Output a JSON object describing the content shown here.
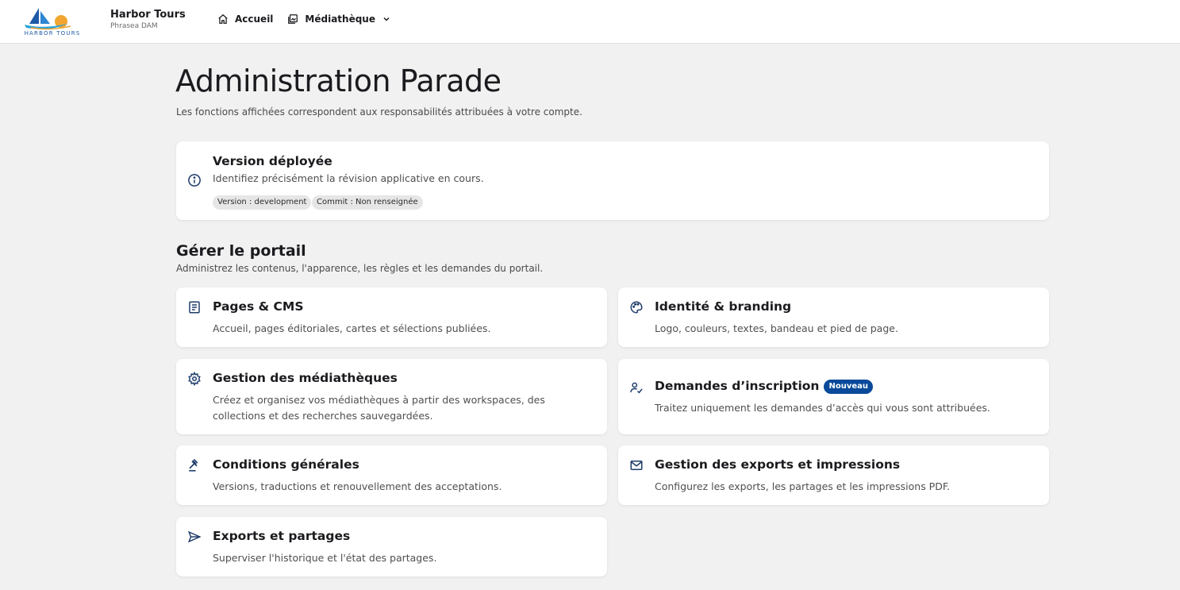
{
  "header": {
    "brand_name": "Harbor Tours",
    "brand_sub": "Phrasea DAM",
    "logo_text": "HARBOR TOURS",
    "nav": [
      {
        "label": "Accueil",
        "icon": "home-icon"
      },
      {
        "label": "Médiathèque",
        "icon": "library-icon"
      }
    ]
  },
  "page": {
    "title": "Administration Parade",
    "subtitle": "Les fonctions affichées correspondent aux responsabilités attribuées à votre compte."
  },
  "version_card": {
    "title": "Version déployée",
    "desc": "Identifiez précisément la révision applicative en cours.",
    "chips": [
      "Version : development",
      "Commit : Non renseignée"
    ],
    "icon": "info-icon"
  },
  "section": {
    "title": "Gérer le portail",
    "subtitle": "Administrez les contenus, l'apparence, les règles et les demandes du portail."
  },
  "cards": [
    {
      "title": "Pages & CMS",
      "desc": "Accueil, pages éditoriales, cartes et sélections publiées.",
      "icon": "document-icon"
    },
    {
      "title": "Identité & branding",
      "desc": "Logo, couleurs, textes, bandeau et pied de page.",
      "icon": "palette-icon"
    },
    {
      "title": "Gestion des médiathèques",
      "desc": "Créez et organisez vos médiathèques à partir des workspaces, des collections et des recherches sauvegardées.",
      "icon": "gear-icon"
    },
    {
      "title": "Demandes d’inscription",
      "badge": "Nouveau",
      "desc": "Traitez uniquement les demandes d’accès qui vous sont attribuées.",
      "icon": "user-check-icon"
    },
    {
      "title": "Conditions générales",
      "desc": "Versions, traductions et renouvellement des acceptations.",
      "icon": "gavel-icon"
    },
    {
      "title": "Gestion des exports et impressions",
      "desc": "Configurez les exports, les partages et les impressions PDF.",
      "icon": "mail-icon"
    },
    {
      "title": "Exports et partages",
      "desc": "Superviser l'historique et l'état des partages.",
      "icon": "send-icon"
    }
  ],
  "colors": {
    "accent": "#0a4a9a",
    "icon": "#1f3d6b",
    "background": "#f1f1f1"
  }
}
